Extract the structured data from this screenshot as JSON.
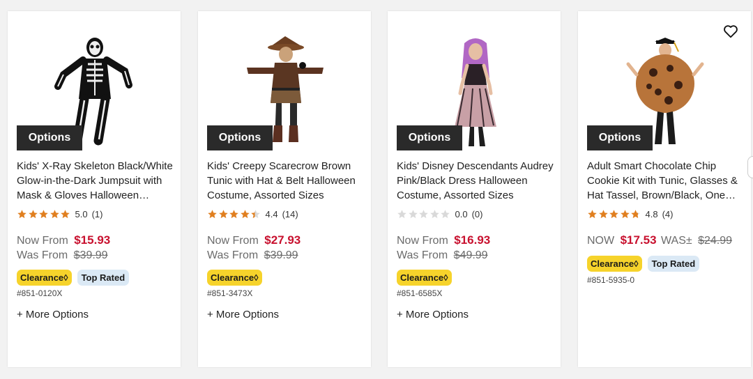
{
  "products": [
    {
      "title": "Kids' X-Ray Skeleton Black/White Glow-in-the-Dark Jumpsuit with Mask & Gloves Halloween…",
      "options_label": "Options",
      "rating_value": "5.0",
      "rating_count": "(1)",
      "stars": 5.0,
      "price_label_1": "Now From",
      "price_1": "$15.93",
      "price_label_2": "Was From",
      "price_2": "$39.99",
      "badge_clearance": "Clearance◊",
      "badge_top": "Top Rated",
      "sku": "#851-0120X",
      "more_options": "+ More Options"
    },
    {
      "title": "Kids' Creepy Scarecrow Brown Tunic with Hat & Belt Halloween Costume, Assorted Sizes",
      "options_label": "Options",
      "rating_value": "4.4",
      "rating_count": "(14)",
      "stars": 4.4,
      "price_label_1": "Now From",
      "price_1": "$27.93",
      "price_label_2": "Was From",
      "price_2": "$39.99",
      "badge_clearance": "Clearance◊",
      "sku": "#851-3473X",
      "more_options": "+ More Options"
    },
    {
      "title": "Kids' Disney Descendants Audrey Pink/Black Dress Halloween Costume, Assorted Sizes",
      "options_label": "Options",
      "rating_value": "0.0",
      "rating_count": "(0)",
      "stars": 0,
      "price_label_1": "Now From",
      "price_1": "$16.93",
      "price_label_2": "Was From",
      "price_2": "$49.99",
      "badge_clearance": "Clearance◊",
      "sku": "#851-6585X",
      "more_options": "+ More Options"
    },
    {
      "title": "Adult Smart Chocolate Chip Cookie Kit with Tunic, Glasses & Hat Tassel, Brown/Black, One…",
      "options_label": "Options",
      "rating_value": "4.8",
      "rating_count": "(4)",
      "stars": 4.8,
      "price_label_1": "NOW",
      "price_1": "$17.53",
      "price_label_2": "WAS±",
      "price_2": "$24.99",
      "badge_clearance": "Clearance◊",
      "badge_top": "Top Rated",
      "sku": "#851-5935-0",
      "wishlist_icon": "heart-outline-icon"
    }
  ],
  "colors": {
    "price_red": "#c8102e",
    "star_orange": "#e07f1f",
    "star_empty": "#d9d9d9",
    "clearance_yellow": "#f6d32b",
    "top_rated_blue": "#dbe9f5",
    "options_button": "#2a2a2a"
  }
}
